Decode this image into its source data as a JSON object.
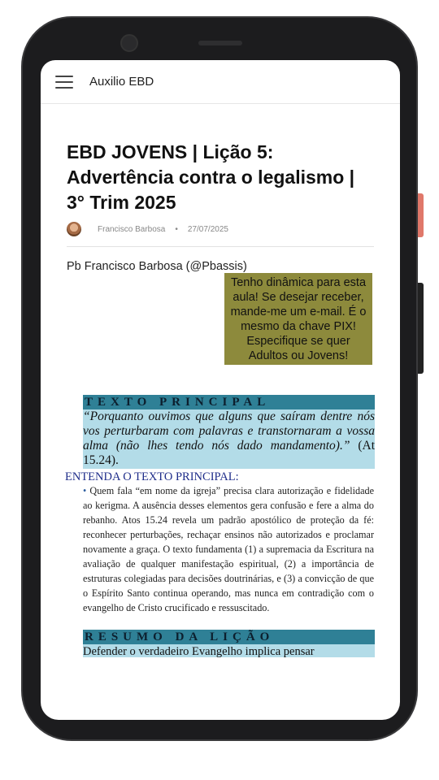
{
  "app": {
    "title": "Auxilio EBD"
  },
  "post": {
    "title": "EBD JOVENS | Lição 5: Advertência contra o legalismo | 3° Trim 2025",
    "author": "Francisco Barbosa",
    "date": "27/07/2025",
    "byline": "Pb Francisco Barbosa (@Pbassis)",
    "callout": "Tenho dinâmica para esta aula! Se desejar receber, mande-me um e-mail. É o mesmo da chave PIX! Especifique se quer Adultos ou Jovens!",
    "texto_principal": {
      "heading": "TEXTO PRINCIPAL",
      "quote": "“Porquanto ouvimos que alguns que saíram dentre nós vos perturbaram com palavras e transtornaram a vossa alma (não lhes tendo nós dado mandamento).”",
      "reference": "(At 15.24)."
    },
    "entenda": {
      "title": "ENTENDA O TEXTO PRINCIPAL:",
      "bullet": "•",
      "text": "Quem fala “em nome da igreja” precisa clara autorização e fidelidade ao kerigma. A ausência desses elementos gera confusão e fere a alma do rebanho. Atos 15.24 revela um padrão apostólico de proteção da fé: reconhecer perturbações, rechaçar ensinos não autorizados e proclamar novamente a graça. O texto fundamenta (1) a supremacia da Escritura na avaliação de qualquer manifestação espiritual, (2) a importância de estruturas colegiadas para decisões doutrinárias, e (3) a convicção de que o Espírito Santo continua operando, mas nunca em contradição com o evangelho de Cristo crucificado e ressuscitado."
    },
    "resumo": {
      "heading": "RESUMO DA LIÇÃO",
      "text": "Defender o verdadeiro Evangelho implica pensar"
    }
  },
  "colors": {
    "callout_bg": "#8d8a3c",
    "heading_bg": "#2f8096",
    "quote_bg": "#b3dce8",
    "entenda_title": "#1f2d8a"
  },
  "icons": {
    "menu": "hamburger-menu-icon",
    "avatar": "author-avatar"
  }
}
